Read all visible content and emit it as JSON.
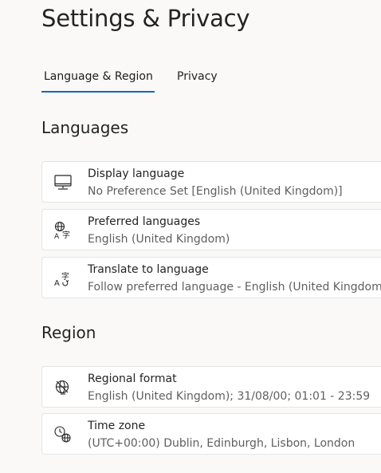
{
  "page": {
    "title": "Settings & Privacy"
  },
  "tabs": [
    {
      "label": "Language & Region",
      "active": true
    },
    {
      "label": "Privacy",
      "active": false
    }
  ],
  "languages": {
    "heading": "Languages",
    "items": [
      {
        "icon": "monitor-icon",
        "label": "Display language",
        "value": "No Preference Set [English (United Kingdom)]"
      },
      {
        "icon": "globe-language-icon",
        "label": "Preferred languages",
        "value": "English (United Kingdom)"
      },
      {
        "icon": "translate-icon",
        "label": "Translate to language",
        "value": "Follow preferred language - English (United Kingdom)"
      }
    ]
  },
  "region": {
    "heading": "Region",
    "items": [
      {
        "icon": "regional-format-icon",
        "label": "Regional format",
        "value": "English (United Kingdom); 31/08/00; 01:01 - 23:59"
      },
      {
        "icon": "time-zone-icon",
        "label": "Time zone",
        "value": "(UTC+00:00) Dublin, Edinburgh, Lisbon, London"
      }
    ]
  },
  "colors": {
    "accent": "#0f6cbd",
    "background": "#faf9f8",
    "card": "#ffffff",
    "secondary_text": "#5f5f5f"
  }
}
